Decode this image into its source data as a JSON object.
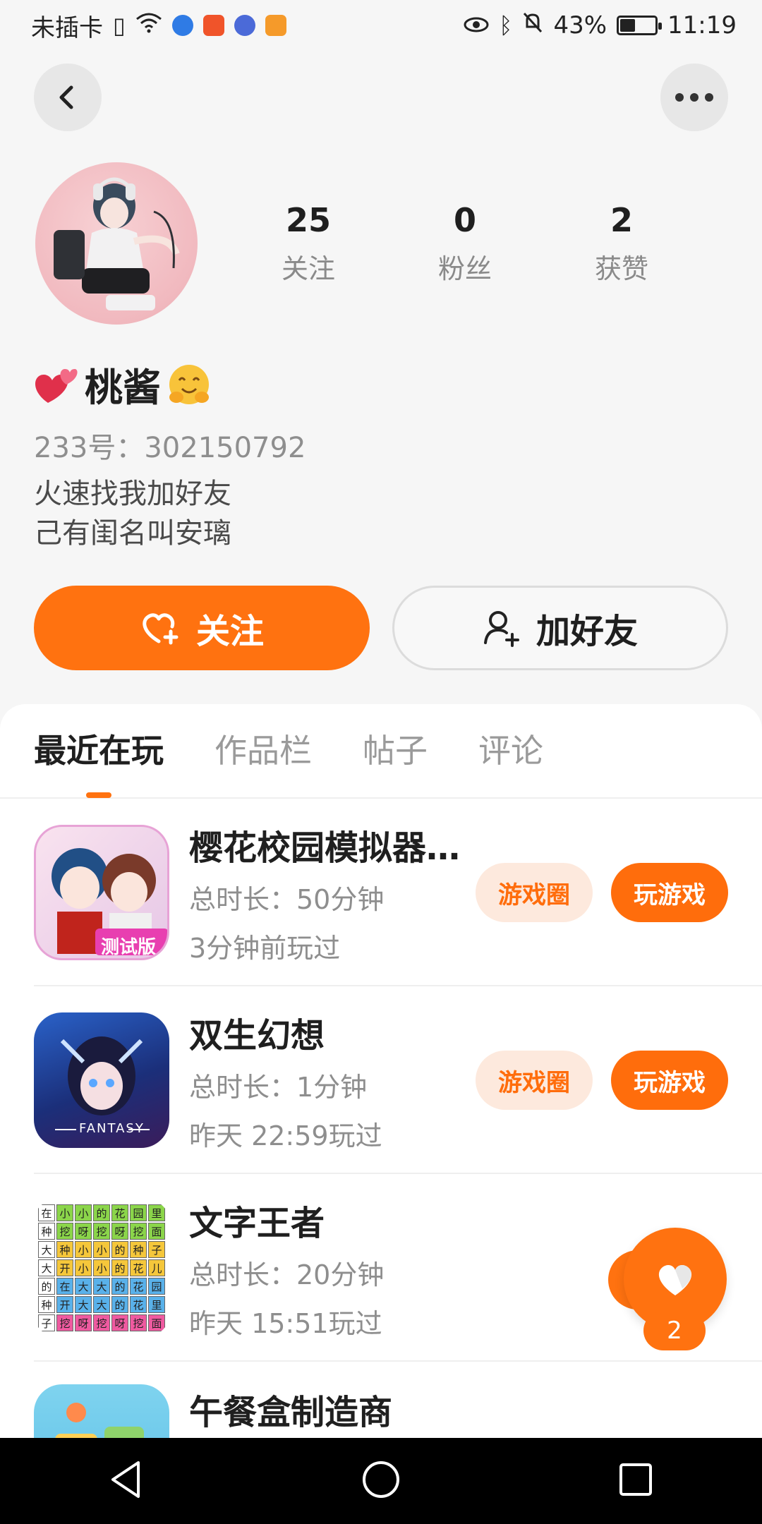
{
  "status_bar": {
    "carrier": "未插卡",
    "battery": "43%",
    "battery_level": 0.43,
    "time": "11:19"
  },
  "profile": {
    "stats": [
      {
        "num": "25",
        "label": "关注"
      },
      {
        "num": "0",
        "label": "粉丝"
      },
      {
        "num": "2",
        "label": "获赞"
      }
    ],
    "name": "桃酱",
    "uid": "233号：302150792",
    "bio_line1": "火速找我加好友",
    "bio_line2": "己有闺名叫安璃",
    "follow_label": "关注",
    "add_friend_label": "加好友"
  },
  "tabs": [
    "最近在玩",
    "作品栏",
    "帖子",
    "评论"
  ],
  "games": [
    {
      "title": "樱花校园模拟器...",
      "duration": "总时长：50分钟",
      "last": "3分钟前玩过",
      "circle_label": "游戏圈",
      "play_label": "玩游戏",
      "badge": "测试版"
    },
    {
      "title": "双生幻想",
      "duration": "总时长：1分钟",
      "last": "昨天 22:59玩过",
      "circle_label": "游戏圈",
      "play_label": "玩游戏",
      "badge": "FANTASY"
    },
    {
      "title": "文字王者",
      "duration": "总时长：20分钟",
      "last": "昨天 15:51玩过"
    },
    {
      "title": "午餐盒制造商"
    }
  ],
  "wordgrid": [
    "在",
    "小",
    "小",
    "的",
    "花",
    "园",
    "里",
    "种",
    "挖",
    "呀",
    "挖",
    "呀",
    "挖",
    "面",
    "大",
    "种",
    "小",
    "小",
    "的",
    "种",
    "子",
    "大",
    "开",
    "小",
    "小",
    "的",
    "花",
    "儿",
    "的",
    "在",
    "大",
    "大",
    "的",
    "花",
    "园",
    "种",
    "开",
    "大",
    "大",
    "的",
    "花",
    "里",
    "子",
    "挖",
    "呀",
    "挖",
    "呀",
    "挖",
    "面"
  ],
  "floating_like": {
    "count": "2"
  }
}
